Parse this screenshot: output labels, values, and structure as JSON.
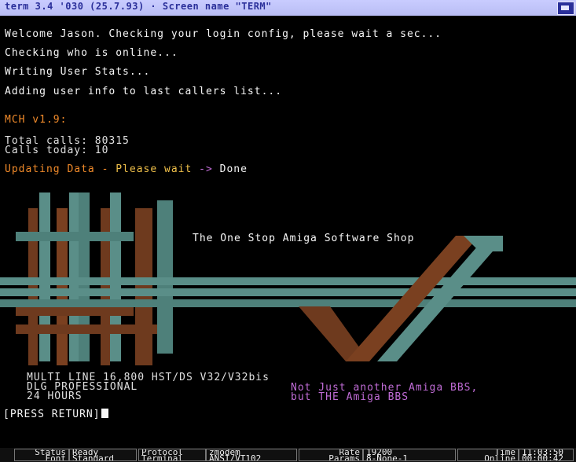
{
  "window": {
    "title": "term 3.4 '030 (25.7.93) · Screen name \"TERM\""
  },
  "terminal": {
    "line1": "Welcome Jason.   Checking your login config, please wait a sec...",
    "line2": "Checking who is online...",
    "line3": "Writing User Stats...",
    "line4": "Adding user info to last callers list...",
    "mch_version": "MCH v1.9:",
    "total_calls": "Total calls: 80315",
    "calls_today": "Calls today: 10",
    "updating_label": "Updating Data",
    "updating_sep": "-",
    "please_wait": "Please wait",
    "arrow": "->",
    "done": "Done",
    "logo_caption": "The One Stop Amiga Software Shop",
    "modem_line1": "MULTI LINE 16,800 HST/DS V32/V32bis",
    "modem_line2": "DLG PROFESSIONAL",
    "modem_line3": "24 HOURS",
    "tagline1": "Not Just another Amiga BBS,",
    "tagline2": "but THE Amiga BBS",
    "prompt": "[PRESS RETURN]"
  },
  "statusbar": {
    "status_label": "Status\n  Font",
    "status_value": "Ready\nStandard",
    "protocol_label": "Protocol\nTerminal",
    "protocol_value": "zmodem\nANSI/VT102",
    "rate_label": "Rate\nParams",
    "rate_value": "19200\n8-None-1",
    "time_label": "Time\nOnline",
    "time_value": "11:03:50\n00:00:42"
  },
  "colors": {
    "title_bg": "#c1c5fa",
    "orange": "#f08a2a",
    "yellow": "#f0c04a",
    "purple": "#c06cd6",
    "logo_teal": "#5a8e88",
    "logo_brown": "#6e3a1e"
  },
  "icons": {
    "depth_gadget": "depth-arrange-icon"
  }
}
